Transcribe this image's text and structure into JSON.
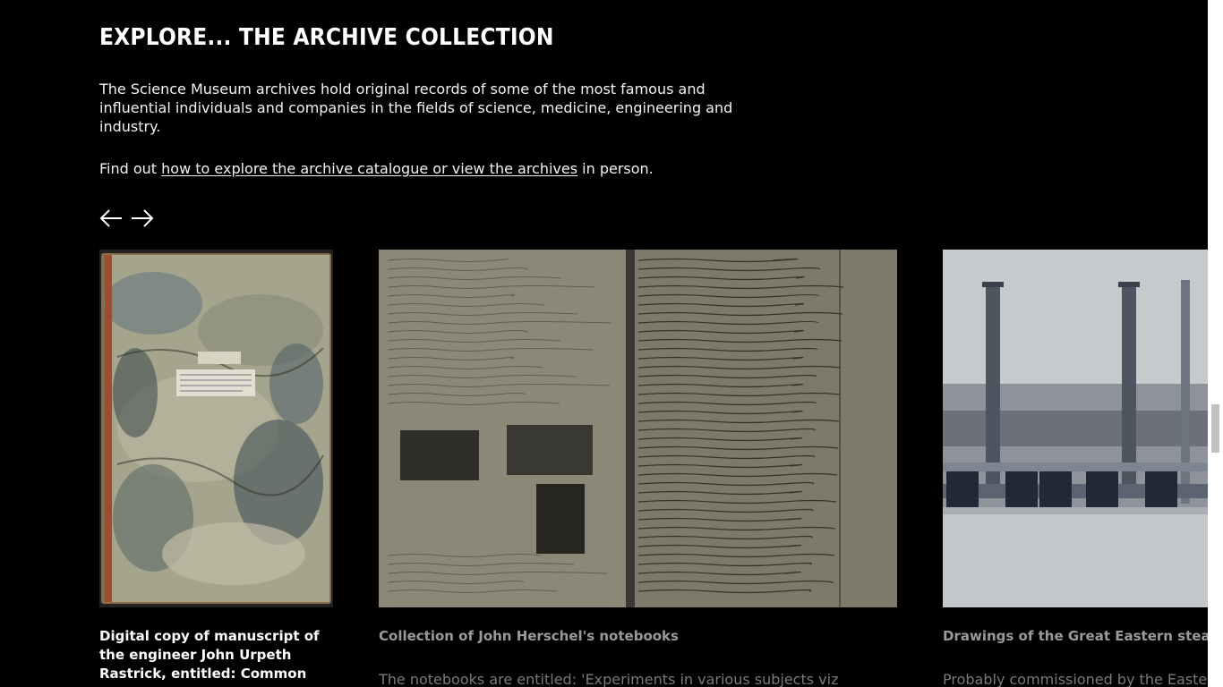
{
  "section": {
    "title": "EXPLORE... THE ARCHIVE COLLECTION",
    "intro": "The Science Museum archives hold original records of some of the most famous and influential individuals and companies in the fields of science, medicine, engineering and industry.",
    "findout_prefix": "Find out ",
    "findout_link": "how to explore the archive catalogue or view the archives",
    "findout_suffix": " in person."
  },
  "carousel": {
    "prev_icon": "arrow-left-icon",
    "next_icon": "arrow-right-icon",
    "cards": [
      {
        "title": "Digital copy of manuscript of the engineer John Urpeth Rastrick, entitled: Common",
        "description": ""
      },
      {
        "title": "Collection of John Herschel's notebooks",
        "description": "The notebooks are entitled: 'Experiments in various subjects viz"
      },
      {
        "title": "Drawings of the Great Eastern steam",
        "description": "Probably commissioned by the Easte"
      }
    ]
  },
  "colors": {
    "background": "#000000",
    "text": "#ffffff",
    "muted_text": "#7a7a7a"
  }
}
